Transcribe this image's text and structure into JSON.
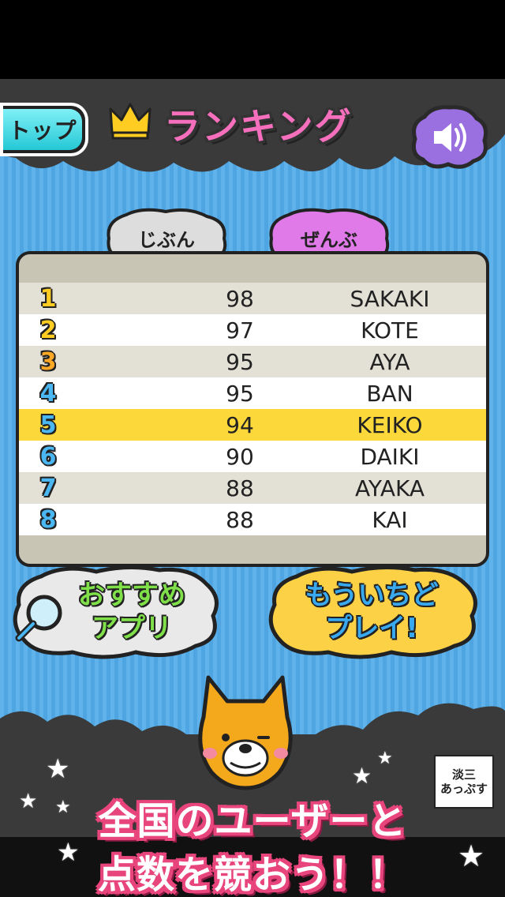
{
  "header": {
    "top_button_label": "トップ",
    "title": "ランキング",
    "crown_icon": "crown-icon",
    "sound_icon": "speaker-icon"
  },
  "tabs": [
    {
      "label": "じぶん",
      "selected": false
    },
    {
      "label": "ぜんぶ",
      "selected": true
    }
  ],
  "ranking": {
    "highlight_rank": "5",
    "rows": [
      {
        "rank": "1",
        "score": "98",
        "name": "SAKAKI"
      },
      {
        "rank": "2",
        "score": "97",
        "name": "KOTE"
      },
      {
        "rank": "3",
        "score": "95",
        "name": "AYA"
      },
      {
        "rank": "4",
        "score": "95",
        "name": "BAN"
      },
      {
        "rank": "5",
        "score": "94",
        "name": "KEIKO"
      },
      {
        "rank": "6",
        "score": "90",
        "name": "DAIKI"
      },
      {
        "rank": "7",
        "score": "88",
        "name": "AYAKA"
      },
      {
        "rank": "8",
        "score": "88",
        "name": "KAI"
      }
    ]
  },
  "buttons": {
    "recommend_line1": "おすすめ",
    "recommend_line2": "アプリ",
    "replay_line1": "もういちど",
    "replay_line2": "プレイ!"
  },
  "promo": {
    "line1": "全国のユーザーと",
    "line2": "点数を競おう！！",
    "logo_line1": "淡三",
    "logo_line2": "あっぷす"
  },
  "colors": {
    "background_blue": "#5fb2ea",
    "title_pink": "#f56fbd",
    "highlight_yellow": "#fcd83a",
    "top_button_cyan": "#3fd5e0",
    "sound_purple": "#9a6fe0",
    "tab_pink": "#e07ae8"
  }
}
